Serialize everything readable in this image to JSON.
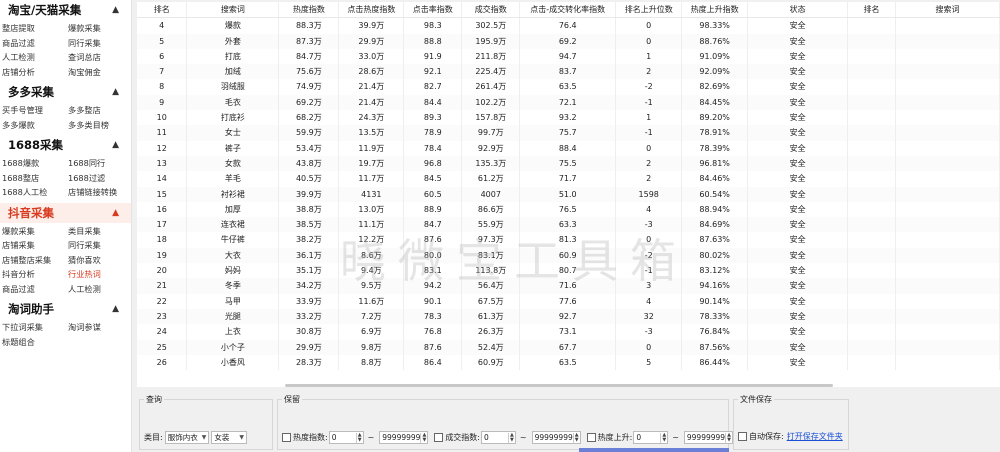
{
  "sidebar": {
    "sections": [
      {
        "title": "淘宝/天猫采集",
        "active": false,
        "items": [
          "整店提取",
          "爆款采集",
          "商品过滤",
          "同行采集",
          "人工检测",
          "查词总店",
          "店铺分析",
          "淘宝佣金"
        ]
      },
      {
        "title": "多多采集",
        "active": false,
        "items": [
          "买手号管理",
          "多多整店",
          "多多爆款",
          "多多类目榜"
        ]
      },
      {
        "title": "1688采集",
        "active": false,
        "items": [
          "1688爆款",
          "1688同行",
          "1688整店",
          "1688过滤",
          "1688人工检",
          "店铺链接转换"
        ]
      },
      {
        "title": "抖音采集",
        "active": true,
        "items": [
          "爆款采集",
          "类目采集",
          "店铺采集",
          "同行采集",
          "店铺整店采集",
          "猜你喜欢",
          "抖音分析",
          "行业热词",
          "商品过滤",
          "人工检测"
        ],
        "active_item": "行业热词"
      },
      {
        "title": "淘词助手",
        "active": false,
        "items": [
          "下拉词采集",
          "淘词参谋",
          "标题组合"
        ]
      }
    ]
  },
  "table": {
    "headers": [
      "排名",
      "搜索词",
      "热度指数",
      "点击热度指数",
      "点击率指数",
      "成交指数",
      "点击-成交转化率指数",
      "排名上升位数",
      "热度上升指数",
      "状态",
      "排名",
      "搜索词"
    ],
    "rows": [
      [
        "4",
        "爆款",
        "88.3万",
        "39.9万",
        "98.3",
        "302.5万",
        "76.4",
        "0",
        "98.33%",
        "安全"
      ],
      [
        "5",
        "外套",
        "87.3万",
        "29.9万",
        "88.8",
        "195.9万",
        "69.2",
        "0",
        "88.76%",
        "安全"
      ],
      [
        "6",
        "打底",
        "84.7万",
        "33.0万",
        "91.9",
        "211.8万",
        "94.7",
        "1",
        "91.09%",
        "安全"
      ],
      [
        "7",
        "加绒",
        "75.6万",
        "28.6万",
        "92.1",
        "225.4万",
        "83.7",
        "2",
        "92.09%",
        "安全"
      ],
      [
        "8",
        "羽绒服",
        "74.9万",
        "21.4万",
        "82.7",
        "261.4万",
        "63.5",
        "-2",
        "82.69%",
        "安全"
      ],
      [
        "9",
        "毛衣",
        "69.2万",
        "21.4万",
        "84.4",
        "102.2万",
        "72.1",
        "-1",
        "84.45%",
        "安全"
      ],
      [
        "10",
        "打底衫",
        "68.2万",
        "24.3万",
        "89.3",
        "157.8万",
        "93.2",
        "1",
        "89.20%",
        "安全"
      ],
      [
        "11",
        "女士",
        "59.9万",
        "13.5万",
        "78.9",
        "99.7万",
        "75.7",
        "-1",
        "78.91%",
        "安全"
      ],
      [
        "12",
        "裤子",
        "53.4万",
        "11.9万",
        "78.4",
        "92.9万",
        "88.4",
        "0",
        "78.39%",
        "安全"
      ],
      [
        "13",
        "女款",
        "43.8万",
        "19.7万",
        "96.8",
        "135.3万",
        "75.5",
        "2",
        "96.81%",
        "安全"
      ],
      [
        "14",
        "羊毛",
        "40.5万",
        "11.7万",
        "84.5",
        "61.2万",
        "71.7",
        "2",
        "84.46%",
        "安全"
      ],
      [
        "15",
        "衬衫裙",
        "39.9万",
        "4131",
        "60.5",
        "4007",
        "51.0",
        "1598",
        "60.54%",
        "安全"
      ],
      [
        "16",
        "加厚",
        "38.8万",
        "13.0万",
        "88.9",
        "86.6万",
        "76.5",
        "4",
        "88.94%",
        "安全"
      ],
      [
        "17",
        "连衣裙",
        "38.5万",
        "11.1万",
        "84.7",
        "55.9万",
        "63.3",
        "-3",
        "84.69%",
        "安全"
      ],
      [
        "18",
        "牛仔裤",
        "38.2万",
        "12.2万",
        "87.6",
        "97.3万",
        "81.3",
        "0",
        "87.63%",
        "安全"
      ],
      [
        "19",
        "大衣",
        "36.1万",
        "8.6万",
        "80.0",
        "83.1万",
        "60.9",
        "-2",
        "80.02%",
        "安全"
      ],
      [
        "20",
        "妈妈",
        "35.1万",
        "9.4万",
        "83.1",
        "113.8万",
        "80.7",
        "-1",
        "83.12%",
        "安全"
      ],
      [
        "21",
        "冬季",
        "34.2万",
        "9.5万",
        "94.2",
        "56.4万",
        "71.6",
        "3",
        "94.16%",
        "安全"
      ],
      [
        "22",
        "马甲",
        "33.9万",
        "11.6万",
        "90.1",
        "67.5万",
        "77.6",
        "4",
        "90.14%",
        "安全"
      ],
      [
        "23",
        "光腿",
        "33.2万",
        "7.2万",
        "78.3",
        "61.3万",
        "92.7",
        "32",
        "78.33%",
        "安全"
      ],
      [
        "24",
        "上衣",
        "30.8万",
        "6.9万",
        "76.8",
        "26.3万",
        "73.1",
        "-3",
        "76.84%",
        "安全"
      ],
      [
        "25",
        "小个子",
        "29.9万",
        "9.8万",
        "87.6",
        "52.4万",
        "67.7",
        "0",
        "87.56%",
        "安全"
      ],
      [
        "26",
        "小香风",
        "28.3万",
        "8.8万",
        "86.4",
        "60.9万",
        "63.5",
        "5",
        "86.44%",
        "安全"
      ]
    ]
  },
  "watermark": "晓微宝工具箱",
  "bottom": {
    "query": {
      "legend": "查询",
      "category_label": "类目:",
      "category1": "服饰内衣",
      "category2": "女装"
    },
    "keep": {
      "legend": "保留",
      "heat_label": "热度指数:",
      "heat_min": "0",
      "heat_max": "99999999",
      "deal_label": "成交指数:",
      "deal_min": "0",
      "deal_max": "99999999",
      "rise_label": "热度上升:",
      "rise_min": "0",
      "rise_max": "99999999",
      "tilde": "~"
    },
    "file": {
      "legend": "文件保存",
      "auto_label": "自动保存:",
      "open_link": "打开保存文件夹"
    }
  }
}
